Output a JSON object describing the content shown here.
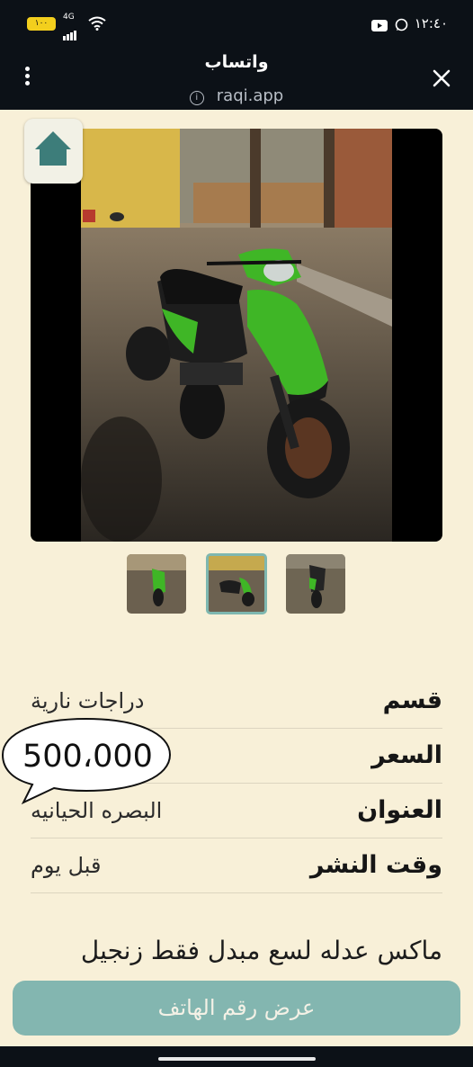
{
  "status_bar": {
    "time": "١٢:٤٠",
    "battery": "١٠٠",
    "network": "4G"
  },
  "header": {
    "title": "واتساب",
    "url": "raqi.app"
  },
  "details": [
    {
      "label": "قسم",
      "value": "دراجات نارية"
    },
    {
      "label": "السعر",
      "value": ""
    },
    {
      "label": "العنوان",
      "value": "البصره الحيانيه"
    },
    {
      "label": "وقت النشر",
      "value": "قبل يوم"
    }
  ],
  "price": "500،000",
  "description": "ماكس عدله لسع مبدل فقط زنجيل",
  "phone_button": "عرض رقم الهاتف",
  "colors": {
    "background": "#f8f0d8",
    "header": "#0c1117",
    "accent": "#83b6b0",
    "scooter_green": "#3fb626"
  },
  "icons": {
    "home": "home-icon",
    "close": "close-icon",
    "menu": "more-vertical-icon"
  }
}
